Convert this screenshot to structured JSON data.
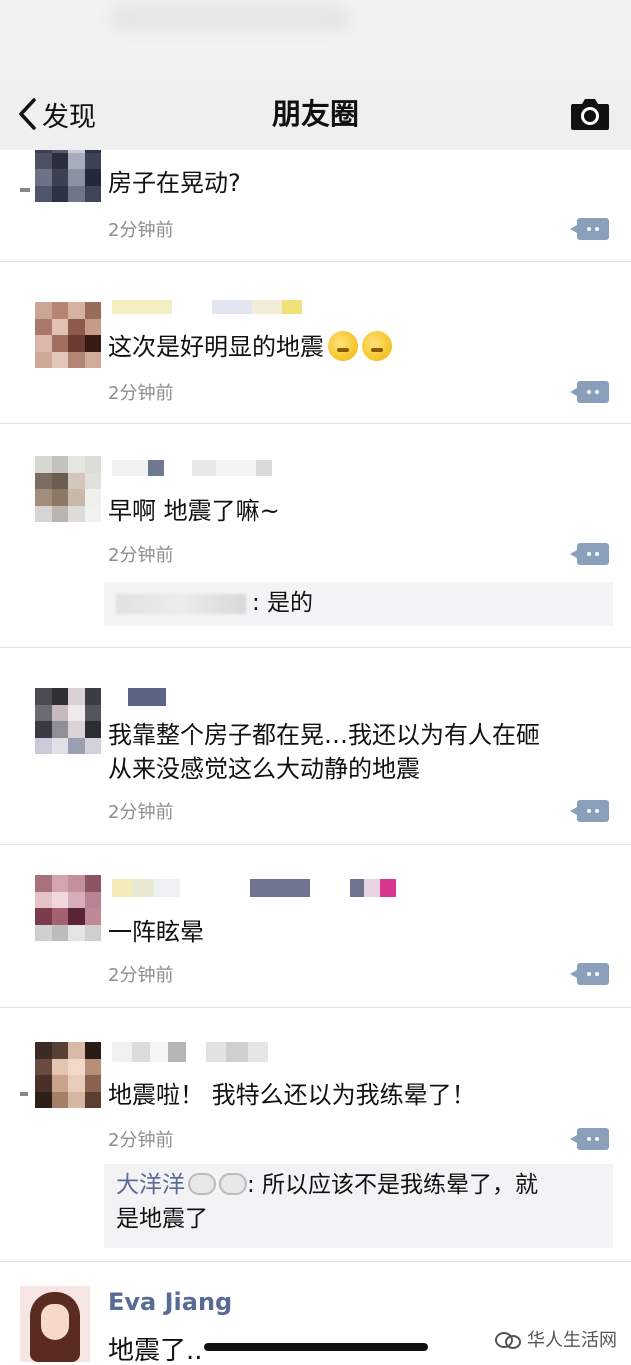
{
  "nav": {
    "back_label": "发现",
    "title": "朋友圈"
  },
  "posts": [
    {
      "content": "房子在晃动?",
      "time": "2分钟前"
    },
    {
      "content": "这次是好明显的地震",
      "time": "2分钟前"
    },
    {
      "content": "早啊 地震了嘛~",
      "time": "2分钟前",
      "comment_text": ": 是的"
    },
    {
      "content_line1": "我靠整个房子都在晃…我还以为有人在砸",
      "content_line2": "从来没感觉这么大动静的地震",
      "time": "2分钟前"
    },
    {
      "content": "一阵眩晕",
      "time": "2分钟前"
    },
    {
      "content": "地震啦！ 我特么还以为我练晕了！",
      "time": "2分钟前",
      "comment_name": "大洋洋",
      "comment_text_line1": ": 所以应该不是我练晕了，就",
      "comment_text_line2": "是地震了"
    }
  ],
  "last_post": {
    "name": "Eva Jiang",
    "content": "地震了.."
  },
  "watermark": "华人生活网",
  "colors": {
    "link": "#576b95",
    "time": "#8d8d8d",
    "more_button": "#8aa0ba"
  },
  "icons": [
    "chevron-left-icon",
    "camera-icon",
    "more-icon",
    "emoji-icon",
    "sheep-icon",
    "wechat-icon"
  ]
}
